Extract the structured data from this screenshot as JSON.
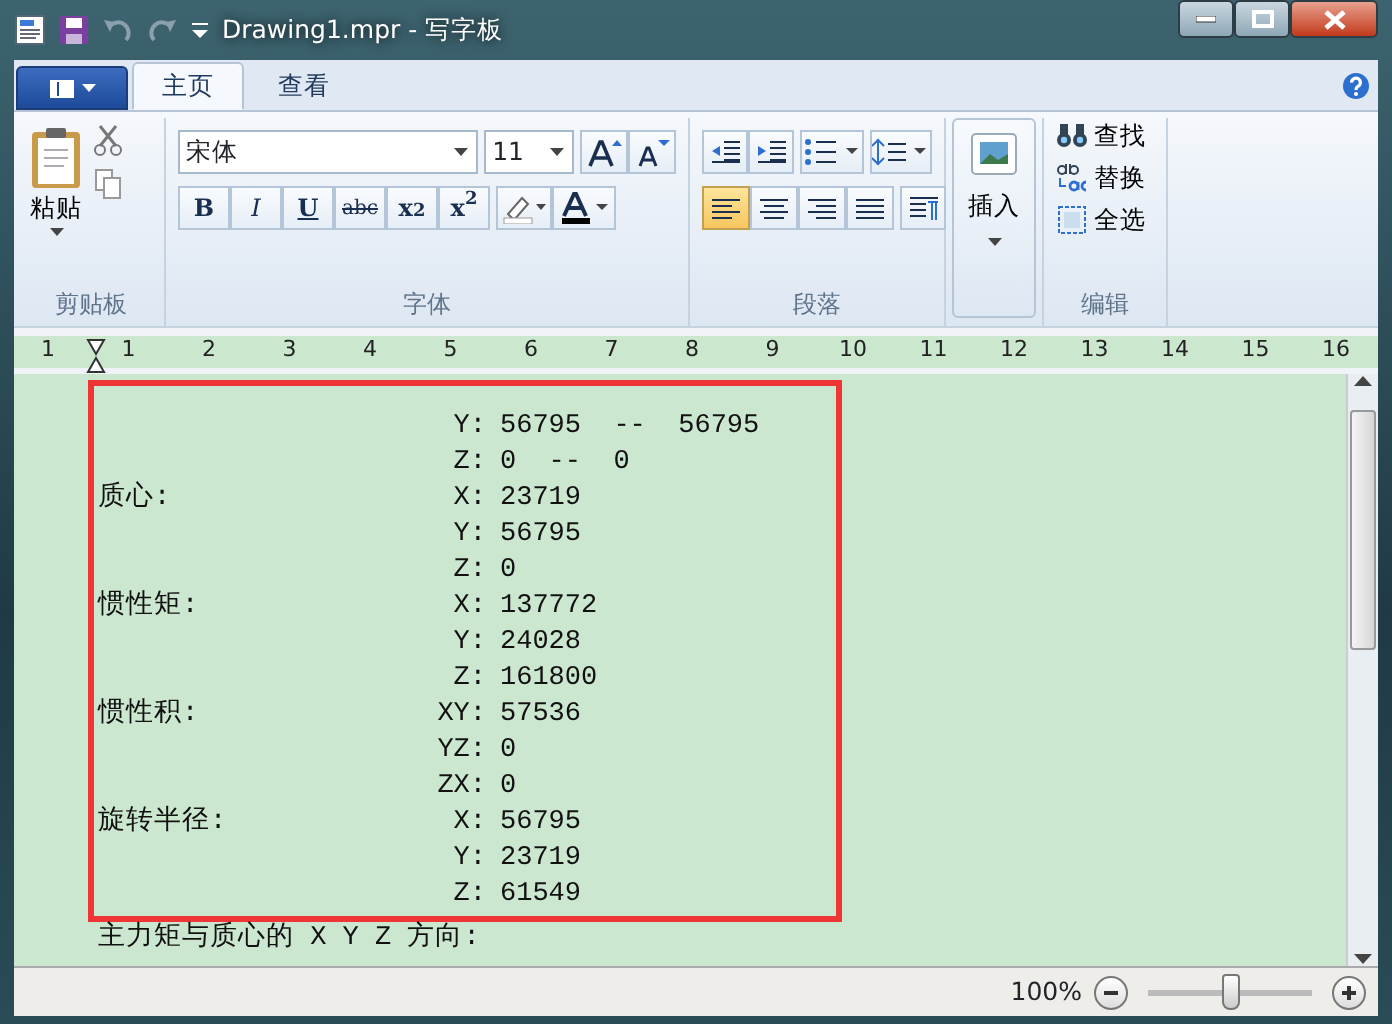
{
  "window": {
    "title": "Drawing1.mpr - 写字板"
  },
  "ribbon_tabs": [
    {
      "label": "主页",
      "selected": true
    },
    {
      "label": "查看",
      "selected": false
    }
  ],
  "clipboard": {
    "paste": "粘贴",
    "group_label": "剪贴板"
  },
  "font": {
    "family": "宋体",
    "size": "11",
    "group_label": "字体",
    "format_buttons": [
      {
        "kind": "bold",
        "text": "B"
      },
      {
        "kind": "italic",
        "text": "I"
      },
      {
        "kind": "underline",
        "text": "U"
      },
      {
        "kind": "strikethrough",
        "text": "abc"
      },
      {
        "kind": "subscript",
        "text": "x$_{2}$"
      },
      {
        "kind": "superscript",
        "text": "x$^{2}$"
      }
    ]
  },
  "paragraph": {
    "group_label": "段落",
    "alignment": [
      {
        "kind": "left",
        "selected": true
      },
      {
        "kind": "center",
        "selected": false
      },
      {
        "kind": "right",
        "selected": false
      },
      {
        "kind": "justify",
        "selected": false
      }
    ]
  },
  "insert": {
    "label": "插入"
  },
  "editing": {
    "group_label": "编辑",
    "items": [
      {
        "kind": "find",
        "label": "查找"
      },
      {
        "kind": "replace",
        "label": "替换"
      },
      {
        "kind": "select_all",
        "label": "全选"
      }
    ]
  },
  "ruler": {
    "numbers": [
      "1",
      "1",
      "2",
      "3",
      "4",
      "5",
      "6",
      "7",
      "8",
      "9",
      "10",
      "11",
      "12",
      "13",
      "14",
      "15",
      "16"
    ]
  },
  "document": {
    "lines": [
      {
        "axis": "Y:",
        "value": "56795  --  56795"
      },
      {
        "axis": "Z:",
        "value": "0  --  0"
      },
      {
        "label": "质心:",
        "axis": "X:",
        "value": "23719"
      },
      {
        "axis": "Y:",
        "value": "56795"
      },
      {
        "axis": "Z:",
        "value": "0"
      },
      {
        "label": "惯性矩:",
        "axis": "X:",
        "value": "137772"
      },
      {
        "axis": "Y:",
        "value": "24028"
      },
      {
        "axis": "Z:",
        "value": "161800"
      },
      {
        "label": "惯性积:",
        "axis": "XY:",
        "value": "57536"
      },
      {
        "axis": "YZ:",
        "value": "0"
      },
      {
        "axis": "ZX:",
        "value": "0"
      },
      {
        "label": "旋转半径:",
        "axis": "X:",
        "value": "56795"
      },
      {
        "axis": "Y:",
        "value": "23719"
      },
      {
        "axis": "Z:",
        "value": "61549"
      }
    ],
    "after_frame": "主力矩与质心的 X Y Z 方向:"
  },
  "status_bar": {
    "zoom": "100%",
    "level": 0.5
  }
}
